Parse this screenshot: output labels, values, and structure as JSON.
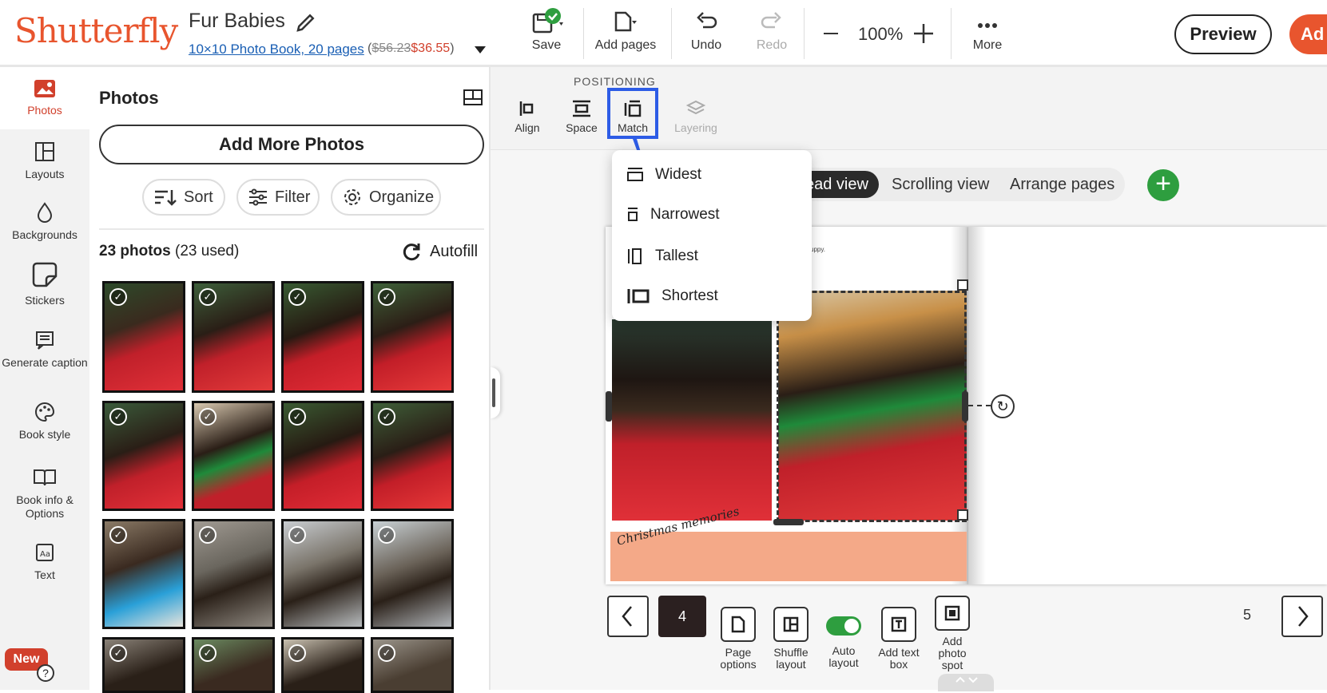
{
  "header": {
    "logo": "Shutterfly",
    "project_title": "Fur Babies",
    "product_link": "10×10 Photo Book, 20 pages",
    "price_open": "(",
    "price_original": "$56.23",
    "price_sale": "$36.55",
    "price_close": ")",
    "toolbar": {
      "save": "Save",
      "add_pages": "Add pages",
      "undo": "Undo",
      "redo": "Redo",
      "zoom": "100%",
      "more": "More"
    },
    "preview": "Preview",
    "add_to_cart": "Ad"
  },
  "left_nav": {
    "items": [
      {
        "label": "Photos",
        "icon": "photo-icon"
      },
      {
        "label": "Layouts",
        "icon": "layout-icon"
      },
      {
        "label": "Backgrounds",
        "icon": "drop-icon"
      },
      {
        "label": "Stickers",
        "icon": "sticker-icon"
      },
      {
        "label": "Generate caption",
        "icon": "caption-icon"
      },
      {
        "label": "Book style",
        "icon": "palette-icon"
      },
      {
        "label": "Book info & Options",
        "icon": "book-icon"
      },
      {
        "label": "Text",
        "icon": "text-icon"
      }
    ],
    "new_badge": "New",
    "help": "?"
  },
  "photos_panel": {
    "title": "Photos",
    "add_more": "Add More Photos",
    "sort": "Sort",
    "filter": "Filter",
    "organize": "Organize",
    "count": "23 photos",
    "used": "(23 used)",
    "autofill": "Autofill",
    "check": "✓"
  },
  "positioning": {
    "label": "POSITIONING",
    "align": "Align",
    "space": "Space",
    "match": "Match",
    "layering": "Layering"
  },
  "match_menu": {
    "widest": "Widest",
    "narrowest": "Narrowest",
    "tallest": "Tallest",
    "shortest": "Shortest"
  },
  "view_switch": {
    "spread": "ead view",
    "scrolling": "Scrolling view",
    "arrange": "Arrange pages"
  },
  "page_text": "uppy.",
  "caption_art": "Christmas memories",
  "pager": {
    "current": "4",
    "next_page": "5"
  },
  "bottom_tools": {
    "page_options": "Page options",
    "shuffle": "Shuffle layout",
    "auto_layout": "Auto layout",
    "add_text": "Add text box",
    "add_photo": "Add photo spot"
  },
  "colors": {
    "brand": "#e8552e",
    "highlight": "#2d5ce6",
    "green": "#2e9e3f",
    "accent_band": "#f4a988"
  }
}
